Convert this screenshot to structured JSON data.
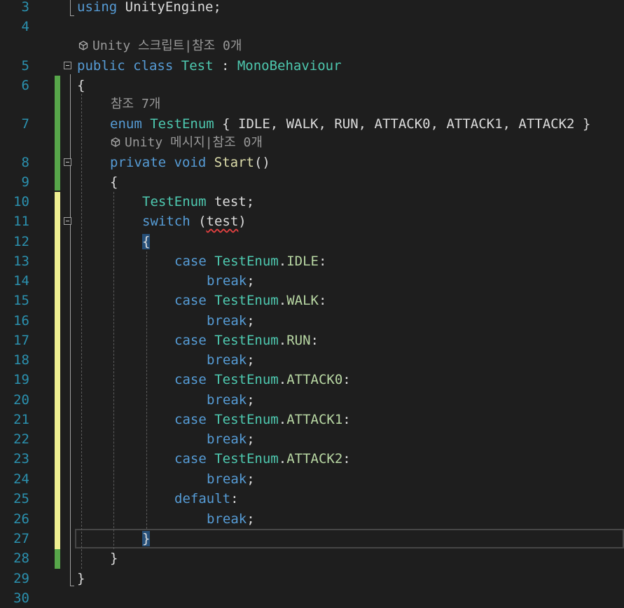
{
  "editor": {
    "lines": [
      {
        "num": "3",
        "segments": [
          {
            "t": "using",
            "c": "kw"
          },
          {
            "t": " UnityEngine;",
            "c": "pl"
          }
        ]
      },
      {
        "num": "4",
        "segments": []
      },
      {
        "num": "5",
        "segments": [
          {
            "t": "public",
            "c": "kw"
          },
          {
            "t": " ",
            "c": "pl"
          },
          {
            "t": "class",
            "c": "kw"
          },
          {
            "t": " ",
            "c": "pl"
          },
          {
            "t": "Test",
            "c": "ty"
          },
          {
            "t": " : ",
            "c": "pl"
          },
          {
            "t": "MonoBehaviour",
            "c": "ty"
          }
        ]
      },
      {
        "num": "6",
        "segments": [
          {
            "t": "{",
            "c": "pl"
          }
        ]
      },
      {
        "num": "7",
        "segments": [
          {
            "t": "enum",
            "c": "kw"
          },
          {
            "t": " ",
            "c": "pl"
          },
          {
            "t": "TestEnum",
            "c": "ty"
          },
          {
            "t": " { IDLE, WALK, RUN, ATTACK0, ATTACK1, ATTACK2 }",
            "c": "pl"
          }
        ]
      },
      {
        "num": "8",
        "segments": [
          {
            "t": "private",
            "c": "kw"
          },
          {
            "t": " ",
            "c": "pl"
          },
          {
            "t": "void",
            "c": "kw"
          },
          {
            "t": " ",
            "c": "pl"
          },
          {
            "t": "Start",
            "c": "fn"
          },
          {
            "t": "()",
            "c": "pl"
          }
        ]
      },
      {
        "num": "9",
        "segments": [
          {
            "t": "{",
            "c": "pl"
          }
        ]
      },
      {
        "num": "10",
        "segments": [
          {
            "t": "TestEnum",
            "c": "ty"
          },
          {
            "t": " test;",
            "c": "pl"
          }
        ]
      },
      {
        "num": "11",
        "segments": [
          {
            "t": "switch",
            "c": "kw"
          },
          {
            "t": " (",
            "c": "pl"
          },
          {
            "t": "test",
            "c": "pl wavy"
          },
          {
            "t": ")",
            "c": "pl"
          }
        ]
      },
      {
        "num": "12",
        "segments": [
          {
            "t": "{",
            "c": "pl hl"
          }
        ]
      },
      {
        "num": "13",
        "segments": [
          {
            "t": "case",
            "c": "kw"
          },
          {
            "t": " ",
            "c": "pl"
          },
          {
            "t": "TestEnum",
            "c": "ty"
          },
          {
            "t": ".",
            "c": "pl"
          },
          {
            "t": "IDLE",
            "c": "en"
          },
          {
            "t": ":",
            "c": "pl"
          }
        ]
      },
      {
        "num": "14",
        "segments": [
          {
            "t": "break",
            "c": "kw"
          },
          {
            "t": ";",
            "c": "pl"
          }
        ]
      },
      {
        "num": "15",
        "segments": [
          {
            "t": "case",
            "c": "kw"
          },
          {
            "t": " ",
            "c": "pl"
          },
          {
            "t": "TestEnum",
            "c": "ty"
          },
          {
            "t": ".",
            "c": "pl"
          },
          {
            "t": "WALK",
            "c": "en"
          },
          {
            "t": ":",
            "c": "pl"
          }
        ]
      },
      {
        "num": "16",
        "segments": [
          {
            "t": "break",
            "c": "kw"
          },
          {
            "t": ";",
            "c": "pl"
          }
        ]
      },
      {
        "num": "17",
        "segments": [
          {
            "t": "case",
            "c": "kw"
          },
          {
            "t": " ",
            "c": "pl"
          },
          {
            "t": "TestEnum",
            "c": "ty"
          },
          {
            "t": ".",
            "c": "pl"
          },
          {
            "t": "RUN",
            "c": "en"
          },
          {
            "t": ":",
            "c": "pl"
          }
        ]
      },
      {
        "num": "18",
        "segments": [
          {
            "t": "break",
            "c": "kw"
          },
          {
            "t": ";",
            "c": "pl"
          }
        ]
      },
      {
        "num": "19",
        "segments": [
          {
            "t": "case",
            "c": "kw"
          },
          {
            "t": " ",
            "c": "pl"
          },
          {
            "t": "TestEnum",
            "c": "ty"
          },
          {
            "t": ".",
            "c": "pl"
          },
          {
            "t": "ATTACK0",
            "c": "en"
          },
          {
            "t": ":",
            "c": "pl"
          }
        ]
      },
      {
        "num": "20",
        "segments": [
          {
            "t": "break",
            "c": "kw"
          },
          {
            "t": ";",
            "c": "pl"
          }
        ]
      },
      {
        "num": "21",
        "segments": [
          {
            "t": "case",
            "c": "kw"
          },
          {
            "t": " ",
            "c": "pl"
          },
          {
            "t": "TestEnum",
            "c": "ty"
          },
          {
            "t": ".",
            "c": "pl"
          },
          {
            "t": "ATTACK1",
            "c": "en"
          },
          {
            "t": ":",
            "c": "pl"
          }
        ]
      },
      {
        "num": "22",
        "segments": [
          {
            "t": "break",
            "c": "kw"
          },
          {
            "t": ";",
            "c": "pl"
          }
        ]
      },
      {
        "num": "23",
        "segments": [
          {
            "t": "case",
            "c": "kw"
          },
          {
            "t": " ",
            "c": "pl"
          },
          {
            "t": "TestEnum",
            "c": "ty"
          },
          {
            "t": ".",
            "c": "pl"
          },
          {
            "t": "ATTACK2",
            "c": "en"
          },
          {
            "t": ":",
            "c": "pl"
          }
        ]
      },
      {
        "num": "24",
        "segments": [
          {
            "t": "break",
            "c": "kw"
          },
          {
            "t": ";",
            "c": "pl"
          }
        ]
      },
      {
        "num": "25",
        "segments": [
          {
            "t": "default",
            "c": "kw"
          },
          {
            "t": ":",
            "c": "pl"
          }
        ]
      },
      {
        "num": "26",
        "segments": [
          {
            "t": "break",
            "c": "kw"
          },
          {
            "t": ";",
            "c": "pl"
          }
        ]
      },
      {
        "num": "27",
        "segments": [
          {
            "t": "}",
            "c": "pl hl"
          }
        ]
      },
      {
        "num": "28",
        "segments": [
          {
            "t": "}",
            "c": "pl"
          }
        ]
      },
      {
        "num": "29",
        "segments": [
          {
            "t": "}",
            "c": "pl"
          }
        ]
      },
      {
        "num": "30",
        "segments": []
      }
    ],
    "codelens": [
      {
        "icon": "unity-cube-icon",
        "text": "Unity 스크립트|참조 0개"
      },
      {
        "icon": "",
        "text": "참조 7개"
      },
      {
        "icon": "unity-cube-icon",
        "text": "Unity 메시지|참조 0개"
      }
    ],
    "colors": {
      "background": "#1e1e1e",
      "line_number": "#2b91af",
      "keyword": "#569cd6",
      "type": "#4ec9b0",
      "enum_member": "#b8d7a3",
      "method": "#dcdcaa",
      "text": "#dcdcdc",
      "codelens": "#999999",
      "saved_change": "#57a64a",
      "unsaved_change": "#efef91",
      "brace_highlight": "#264f78"
    }
  }
}
